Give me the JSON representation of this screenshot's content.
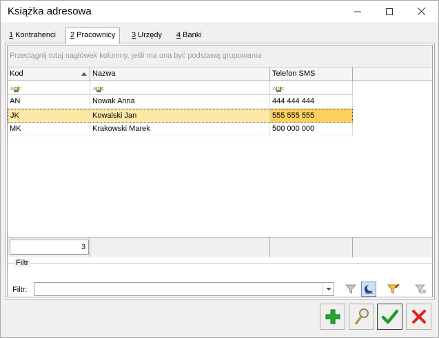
{
  "window": {
    "title": "Książka adresowa",
    "controls": {
      "minimize": "—",
      "maximize": "☐",
      "close": "✕"
    }
  },
  "tabs": [
    {
      "key": "1",
      "label": " Kontrahenci"
    },
    {
      "key": "2",
      "label": " Pracownicy"
    },
    {
      "key": "3",
      "label": " Urzędy"
    },
    {
      "key": "4",
      "label": " Banki"
    }
  ],
  "grid": {
    "group_hint": "Przeciągnij tutaj nagłówek kolumny, jeśli ma ona być podstawą grupowania",
    "columns": [
      "Kod",
      "Nazwa",
      "Telefon SMS"
    ],
    "filter_icon_text": {
      "top": "A",
      "mid": "B",
      "end": "C"
    },
    "rows": [
      {
        "kod": "AN",
        "nazwa": "Nowak Anna",
        "telefon": "444 444 444"
      },
      {
        "kod": "JK",
        "nazwa": "Kowalski Jan",
        "telefon": "555 555 555"
      },
      {
        "kod": "MK",
        "nazwa": "Krakowski Marek",
        "telefon": "500 000 000"
      }
    ],
    "selected_row": 1,
    "row_count": "3"
  },
  "filter": {
    "group_label": "Filtr",
    "label": "Filtr:",
    "value": ""
  },
  "icons": {
    "filter_icon": "funnel-icon",
    "filter_active_icon": "moon-filter-icon",
    "filter_construct_icon": "funnel-edit-icon",
    "filter_clear_icon": "funnel-clear-icon",
    "add_icon": "plus-icon",
    "preview_icon": "magnifier-icon",
    "ok_icon": "checkmark-icon",
    "cancel_icon": "x-icon"
  },
  "colors": {
    "selected_row": "#fde8a5",
    "focused_cell": "#ffd15c",
    "add_green": "#22a92a",
    "ok_green": "#1e9b2a",
    "cancel_red": "#e02020"
  }
}
